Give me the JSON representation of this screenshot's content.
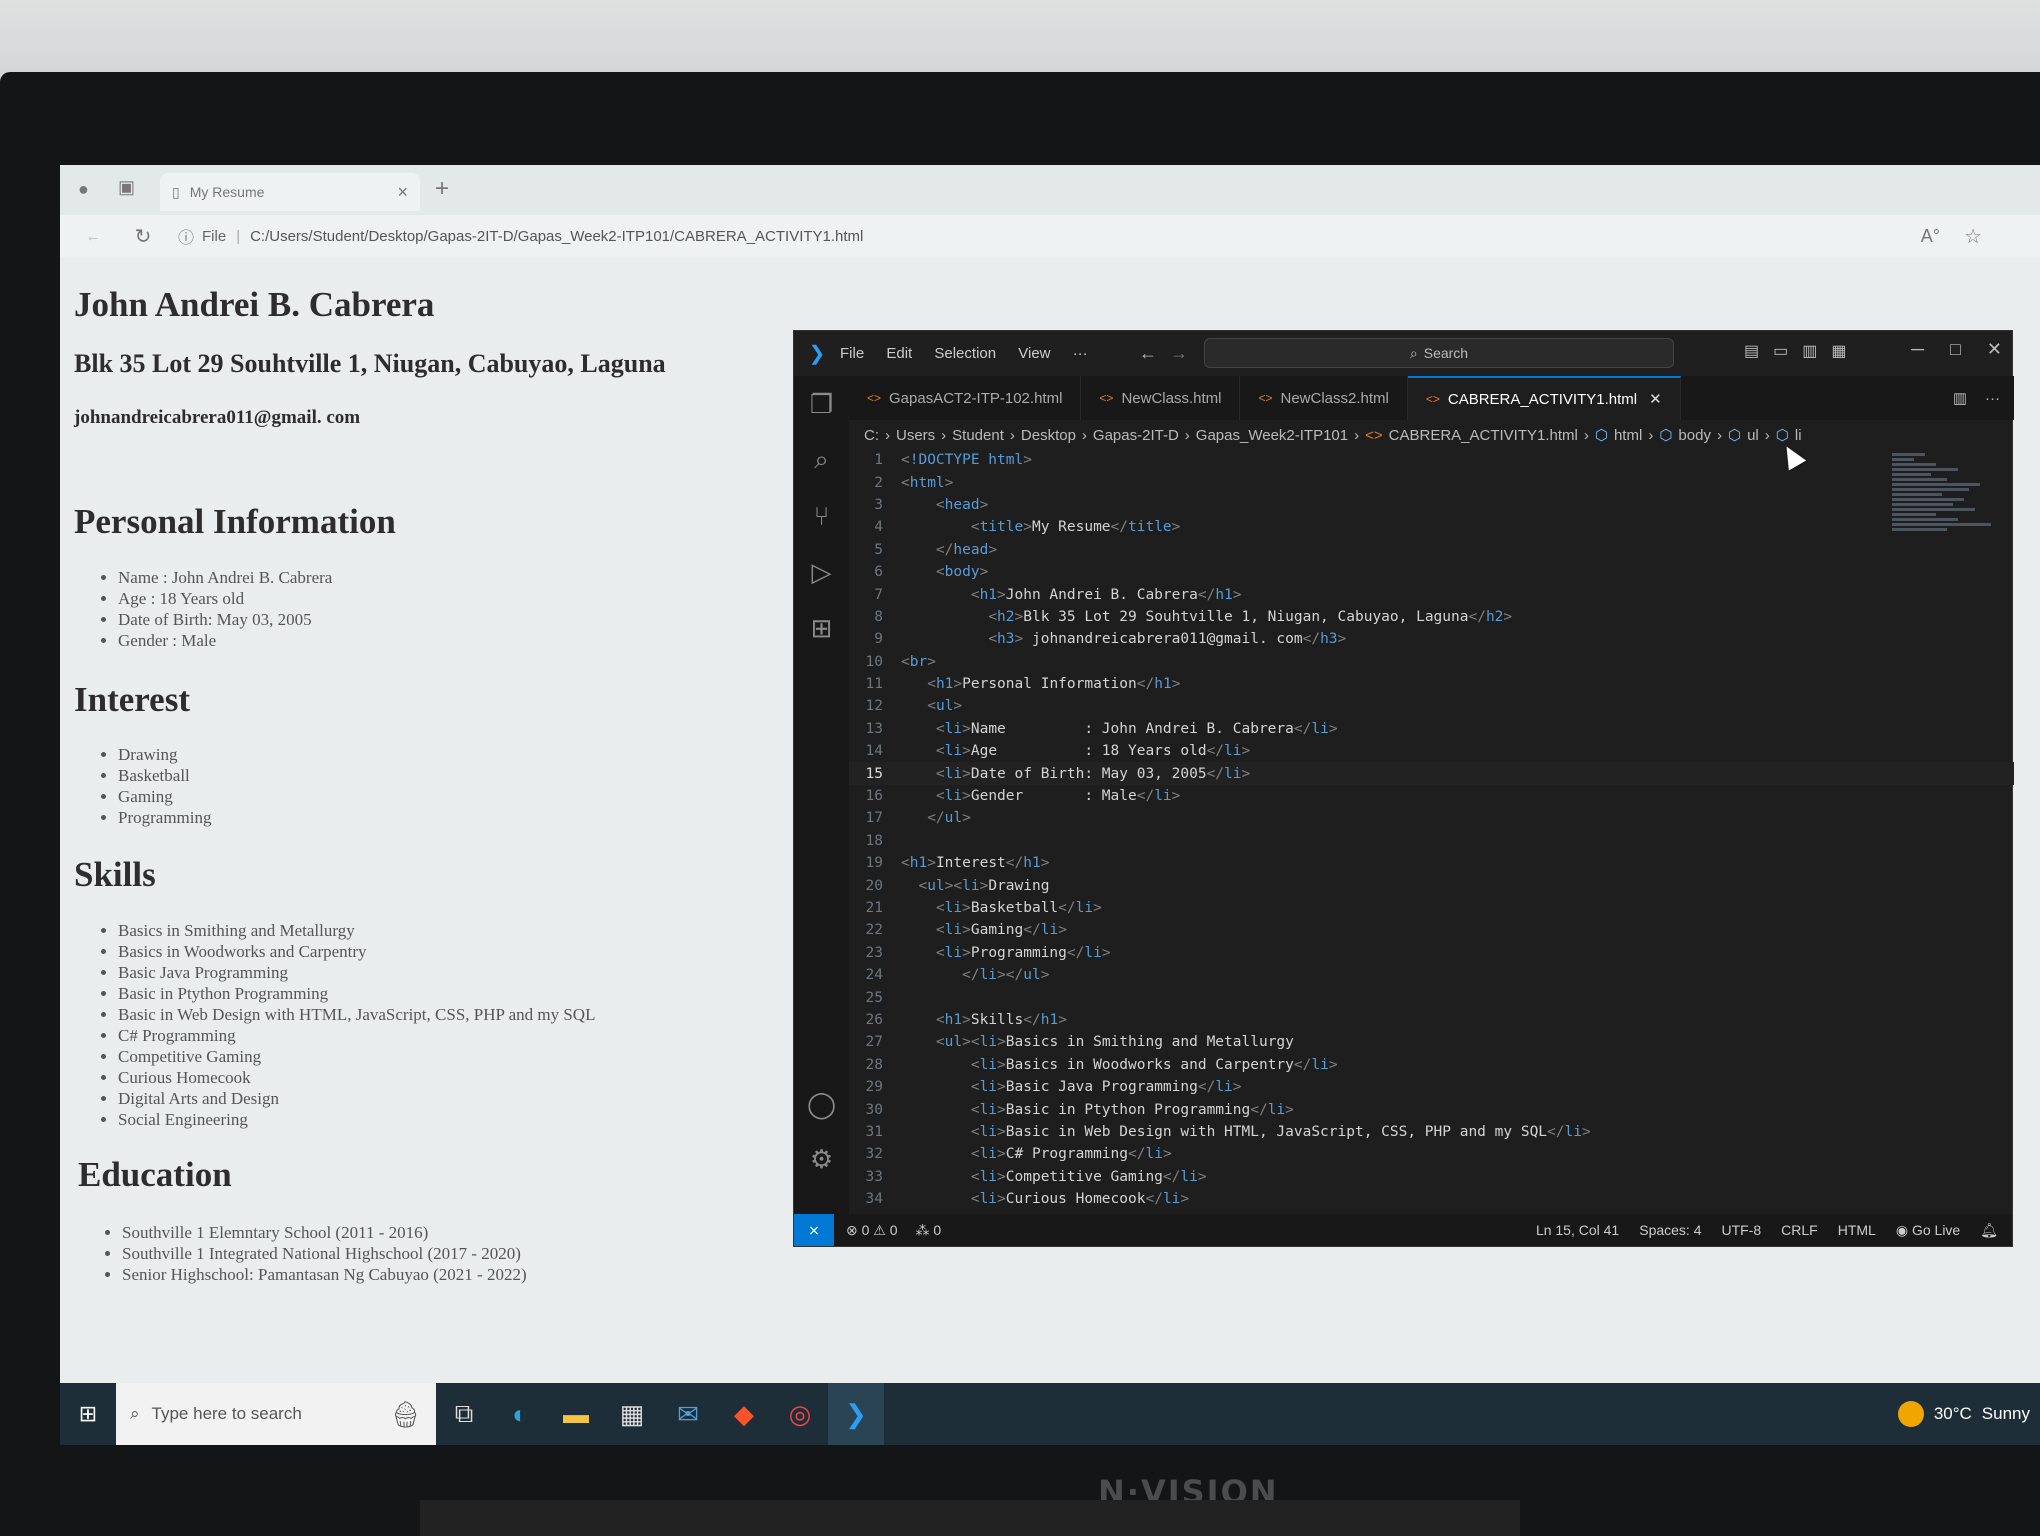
{
  "browser": {
    "tab_title": "My Resume",
    "tab_close": "×",
    "new_tab": "+",
    "address_scheme": "File",
    "address_url": "C:/Users/Student/Desktop/Gapas-2IT-D/Gapas_Week2-ITP101/CABRERA_ACTIVITY1.html"
  },
  "resume": {
    "name": "John Andrei B. Cabrera",
    "address": "Blk 35 Lot 29 Souhtville 1, Niugan, Cabuyao, Laguna",
    "email": "johnandreicabrera011@gmail. com",
    "personal_heading": "Personal Information",
    "personal_items": [
      "Name : John Andrei B. Cabrera",
      "Age : 18 Years old",
      "Date of Birth: May 03, 2005",
      "Gender : Male"
    ],
    "interest_heading": "Interest",
    "interest_items": [
      "Drawing",
      "Basketball",
      "Gaming",
      "Programming"
    ],
    "skills_heading": "Skills",
    "skills_items": [
      "Basics in Smithing and Metallurgy",
      "Basics in Woodworks and Carpentry",
      "Basic Java Programming",
      "Basic in Ptython Programming",
      "Basic in Web Design with HTML, JavaScript, CSS, PHP and my SQL",
      "C# Programming",
      "Competitive Gaming",
      "Curious Homecook",
      "Digital Arts and Design",
      "Social Engineering"
    ],
    "education_heading": "Education",
    "education_items": [
      "Southville 1 Elemntary School (2011 - 2016)",
      "Southville 1 Integrated National Highschool (2017 - 2020)",
      "Senior Highschool: Pamantasan Ng Cabuyao (2021 - 2022)"
    ]
  },
  "vscode": {
    "menu": [
      "File",
      "Edit",
      "Selection",
      "View",
      "···"
    ],
    "search_placeholder": "Search",
    "tabs": [
      "GapasACT2-ITP-102.html",
      "NewClass.html",
      "NewClass2.html",
      "CABRERA_ACTIVITY1.html"
    ],
    "breadcrumb": [
      "C:",
      "Users",
      "Student",
      "Desktop",
      "Gapas-2IT-D",
      "Gapas_Week2-ITP101",
      "CABRERA_ACTIVITY1.html",
      "html",
      "body",
      "ul",
      "li"
    ],
    "current_line": 15,
    "code_lines": [
      "<!DOCTYPE html>",
      "<html>",
      "    <head>",
      "        <title>My Resume</title>",
      "    </head>",
      "    <body>",
      "        <h1>John Andrei B. Cabrera</h1>",
      "          <h2>Blk 35 Lot 29 Souhtville 1, Niugan, Cabuyao, Laguna</h2>",
      "          <h3> johnandreicabrera011@gmail. com</h3>",
      "<br>",
      "   <h1>Personal Information</h1>",
      "   <ul>",
      "    <li>Name         : John Andrei B. Cabrera</li>",
      "    <li>Age          : 18 Years old</li>",
      "    <li>Date of Birth: May 03, 2005</li>",
      "    <li>Gender       : Male</li>",
      "   </ul>",
      "",
      "<h1>Interest</h1>",
      "  <ul><li>Drawing",
      "    <li>Basketball</li>",
      "    <li>Gaming</li>",
      "    <li>Programming</li>",
      "       </li></ul>",
      "",
      "    <h1>Skills</h1>",
      "    <ul><li>Basics in Smithing and Metallurgy",
      "        <li>Basics in Woodworks and Carpentry</li>",
      "        <li>Basic Java Programming</li>",
      "        <li>Basic in Ptython Programming</li>",
      "        <li>Basic in Web Design with HTML, JavaScript, CSS, PHP and my SQL</li>",
      "        <li>C# Programming</li>",
      "        <li>Competitive Gaming</li>",
      "        <li>Curious Homecook</li>"
    ],
    "status": {
      "errors": "⊗ 0 ⚠ 0",
      "ports": "⁂ 0",
      "position": "Ln 15, Col 41",
      "spaces": "Spaces: 4",
      "encoding": "UTF-8",
      "eol": "CRLF",
      "language": "HTML",
      "golive": "Go Live"
    }
  },
  "taskbar": {
    "search_placeholder": "Type here to search",
    "temperature": "30°C",
    "weather": "Sunny"
  },
  "monitor_brand": "N·VISION"
}
